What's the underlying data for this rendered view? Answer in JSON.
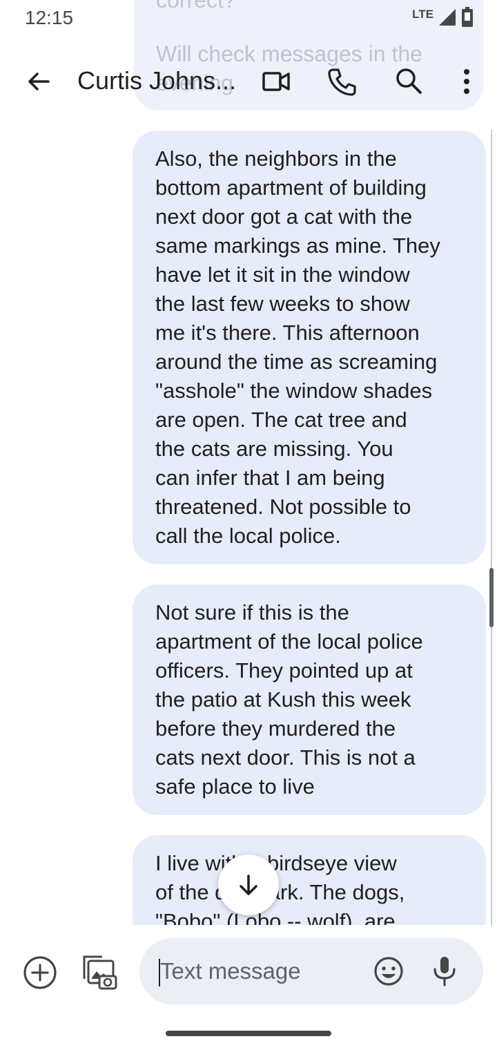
{
  "status": {
    "time": "12:15",
    "network": "LTE"
  },
  "partial_previous": {
    "line1": "correct?",
    "line2": "Will check messages in the",
    "line3": "evening"
  },
  "topbar": {
    "contact_name": "Curtis Johns..."
  },
  "messages": [
    {
      "text": "Also, the neighbors in the\nbottom apartment of building\nnext door got a cat with the\nsame markings as mine. They\nhave let it sit in the window\nthe last few weeks to show\nme it's there. This afternoon\naround the time as screaming\n\"asshole\" the window shades\nare open. The cat tree and\nthe cats are missing. You\ncan infer that I am being\nthreatened. Not possible to\ncall the local police."
    },
    {
      "text": "Not sure if this is the\napartment of the local police\nofficers. They pointed up at\nthe patio at Kush this week\nbefore they murdered the\ncats next door. This is not a\nsafe place to live"
    },
    {
      "text": "I live with a birdseye view\nof the dog park. The dogs,\n\"Bobo\" (Lobo -- wolf), are"
    }
  ],
  "compose": {
    "placeholder": "Text message"
  },
  "icons": {
    "back": "arrow-back-icon",
    "video": "videocam-icon",
    "call": "phone-icon",
    "search": "search-icon",
    "more": "more-vert-icon",
    "add": "add-circle-icon",
    "gallery": "photo-camera-icon",
    "emoji": "emoji-icon",
    "mic": "mic-icon",
    "scroll": "arrow-down-icon",
    "signal": "signal-icon",
    "battery": "battery-icon"
  },
  "colors": {
    "outgoing_bubble": "#e6ecf9",
    "compose_field": "#ebeef5",
    "icon": "#444746",
    "text": "#1f1f1f"
  }
}
